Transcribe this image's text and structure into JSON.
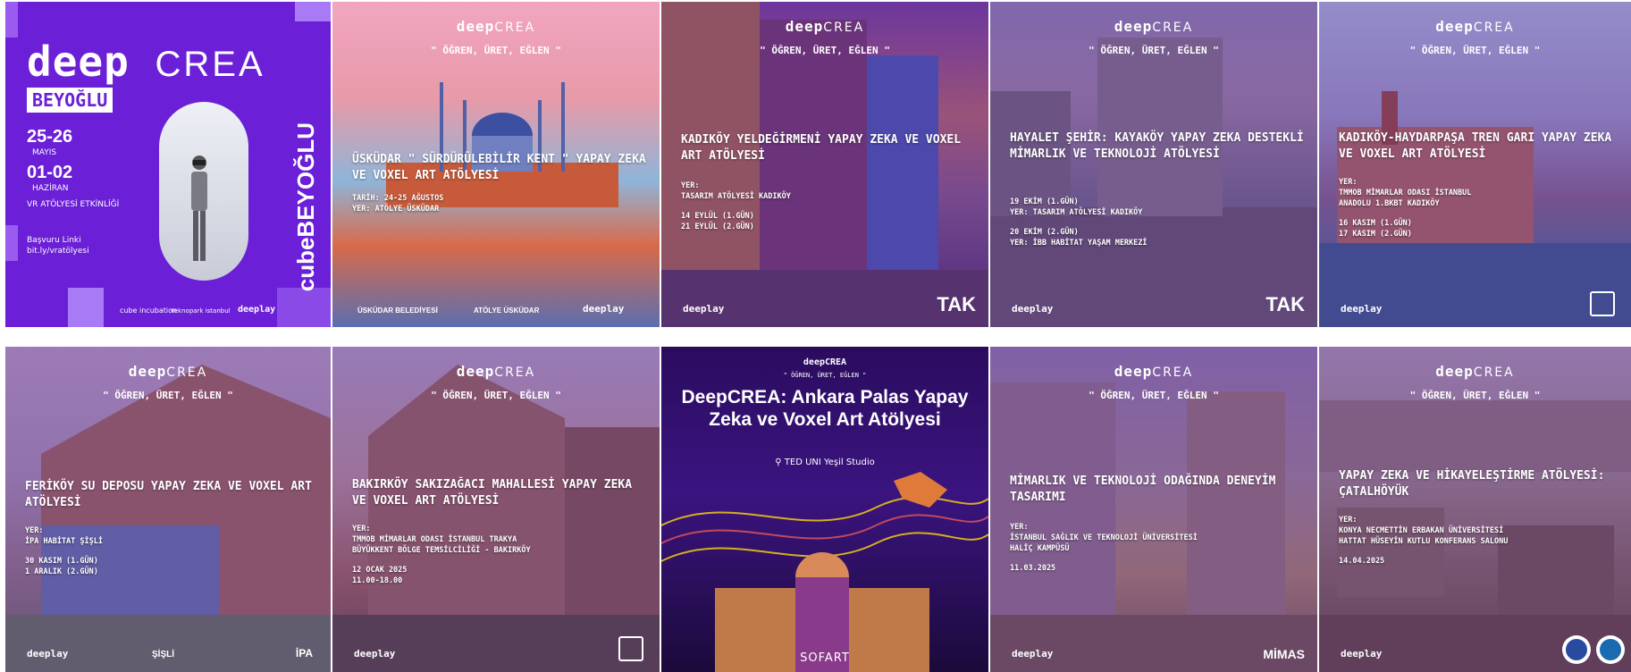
{
  "cards": [
    {
      "logo_deep": "deep",
      "logo_crea": "CREA",
      "district": "BEYOĞLU",
      "date1": "25-26",
      "month1": "MAYIS",
      "date2": "01-02",
      "month2": "HAZİRAN",
      "activity": "VR ATÖLYESİ ETKİNLİĞİ",
      "link_label": "Başvuru Linki",
      "link": "bit.ly/vratölyesi",
      "vertical_brand": "cubeBEYOĞLU",
      "footer_1": "cube incubation",
      "footer_2": "teknopark istanbul",
      "footer_3": "deeplay"
    },
    {
      "brand_deep": "deep",
      "brand_crea": "CREA",
      "slogan": "\" ÖĞREN, ÜRET, EĞLEN \"",
      "title": "ÜSKÜDAR \" SÜRDÜRÜLEBİLİR KENT \" YAPAY ZEKA VE VOXEL ART ATÖLYESİ",
      "info_lines": [
        "TARİH: 24-25 AĞUSTOS",
        "YER: ATÖLYE ÜSKÜDAR"
      ],
      "footer_left": "ÜSKÜDAR BELEDİYESİ",
      "footer_mid": "ATÖLYE ÜSKÜDAR",
      "footer_right": "deeplay"
    },
    {
      "brand_deep": "deep",
      "brand_crea": "CREA",
      "slogan": "\" ÖĞREN, ÜRET, EĞLEN \"",
      "title": "KADIKÖY YELDEĞİRMENİ YAPAY ZEKA VE VOXEL ART ATÖLYESİ",
      "info_lines": [
        "YER:",
        "TASARIM ATÖLYESİ KADIKÖY",
        "",
        "14 EYLÜL (1.GÜN)",
        "21 EYLÜL (2.GÜN)"
      ],
      "footer_left": "deeplay",
      "footer_right": "TAK"
    },
    {
      "brand_deep": "deep",
      "brand_crea": "CREA",
      "slogan": "\" ÖĞREN, ÜRET, EĞLEN \"",
      "title": "HAYALET ŞEHİR: KAYAKÖY YAPAY ZEKA DESTEKLİ MİMARLIK VE TEKNOLOJİ ATÖLYESİ",
      "info_lines": [
        "19 EKİM (1.GÜN)",
        "YER: TASARIM ATÖLYESİ KADIKÖY",
        "",
        "20 EKİM (2.GÜN)",
        "YER: İBB HABİTAT YAŞAM MERKEZİ"
      ],
      "footer_left": "deeplay",
      "footer_right": "TAK"
    },
    {
      "brand_deep": "deep",
      "brand_crea": "CREA",
      "slogan": "\" ÖĞREN, ÜRET, EĞLEN \"",
      "title": "KADIKÖY-HAYDARPAŞA TREN GARI YAPAY ZEKA VE VOXEL ART ATÖLYESİ",
      "info_lines": [
        "YER:",
        "TMMOB MİMARLAR ODASI İSTANBUL",
        "ANADOLU 1.BKBT KADIKÖY",
        "",
        "16 KASIM (1.GÜN)",
        "17 KASIM (2.GÜN)"
      ],
      "footer_left": "deeplay"
    },
    {
      "brand_deep": "deep",
      "brand_crea": "CREA",
      "slogan": "\" ÖĞREN, ÜRET, EĞLEN \"",
      "title": "FERİKÖY SU DEPOSU YAPAY ZEKA VE VOXEL ART ATÖLYESİ",
      "info_lines": [
        "YER:",
        "İPA HABİTAT ŞİŞLİ",
        "",
        "30 KASIM (1.GÜN)",
        "1 ARALIK (2.GÜN)"
      ],
      "footer_left": "deeplay",
      "footer_mid": "ŞİŞLİ",
      "footer_right": "İPA"
    },
    {
      "brand_deep": "deep",
      "brand_crea": "CREA",
      "slogan": "\" ÖĞREN, ÜRET, EĞLEN \"",
      "title": "BAKIRKÖY SAKIZAĞACI MAHALLESİ YAPAY ZEKA VE VOXEL ART ATÖLYESİ",
      "info_lines": [
        "YER:",
        "TMMOB MİMARLAR ODASI İSTANBUL TRAKYA",
        "BÜYÜKKENT BÖLGE TEMSİLCİLİĞİ - BAKIRKÖY",
        "",
        "12 OCAK 2025",
        "11.00-18.00"
      ],
      "footer_left": "deeplay"
    },
    {
      "brand_deep": "deep",
      "brand_crea": "CREA",
      "slogan": "\" ÖĞREN, ÜRET, EĞLEN \"",
      "title": "DeepCREA: Ankara Palas Yapay Zeka ve Voxel Art Atölyesi",
      "location": "TED UNI Yeşil Studio",
      "footer_center": "SOFART"
    },
    {
      "brand_deep": "deep",
      "brand_crea": "CREA",
      "slogan": "\" ÖĞREN, ÜRET, EĞLEN \"",
      "title": "MİMARLIK VE TEKNOLOJİ ODAĞINDA DENEYİM TASARIMI",
      "info_lines": [
        "YER:",
        "İSTANBUL SAĞLIK VE TEKNOLOJİ ÜNİVERSİTESİ",
        "HALİÇ KAMPÜSÜ",
        "",
        "11.03.2025"
      ],
      "footer_left": "deeplay",
      "footer_right": "MİMAS"
    },
    {
      "brand_deep": "deep",
      "brand_crea": "CREA",
      "slogan": "\" ÖĞREN, ÜRET, EĞLEN \"",
      "title": "YAPAY ZEKA VE HİKAYELEŞTİRME ATÖLYESİ: ÇATALHÖYÜK",
      "info_lines": [
        "YER:",
        "KONYA NECMETTİN ERBAKAN ÜNİVERSİTESİ",
        "HATTAT HÜSEYİN KUTLU KONFERANS SALONU",
        "",
        "14.04.2025"
      ],
      "footer_left": "deeplay"
    }
  ]
}
